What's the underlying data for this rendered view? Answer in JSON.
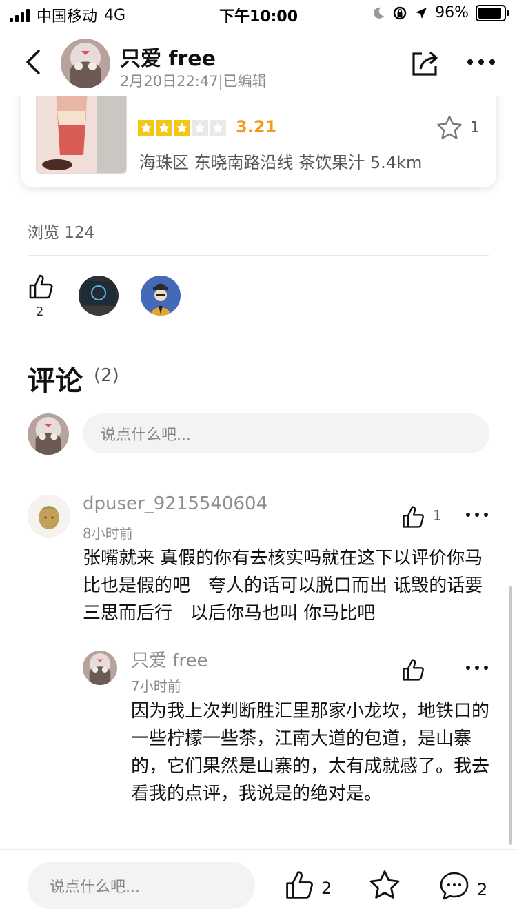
{
  "status_bar": {
    "carrier": "中国移动",
    "network": "4G",
    "time": "下午10:00",
    "battery": "96%"
  },
  "header": {
    "author": "只爱 free",
    "meta": "2月20日22:47|已编辑"
  },
  "shop": {
    "rating": "3.21",
    "rating_value": 3.21,
    "stars_filled": 3,
    "stars_total": 5,
    "info": "海珠区 东晓南路沿线 茶饮果汁   5.4km",
    "favorite_count": "1"
  },
  "stats": {
    "views": "浏览 124",
    "like_count": "2"
  },
  "comments": {
    "title": "评论",
    "count": "(2)",
    "input_placeholder": "说点什么吧...",
    "items": [
      {
        "user": "dpuser_9215540604",
        "time": "8小时前",
        "text": "张嘴就来 真假的你有去核实吗就在这下以评价你马比也是假的吧　夸人的话可以脱口而出 诋毁的话要三思而后行　以后你马也叫 你马比吧",
        "likes": "1"
      }
    ],
    "reply": {
      "user": "只爱 free",
      "time": "7小时前",
      "text": "因为我上次判断胜汇里那家小龙坎，地铁口的一些柠檬一些茶，江南大道的包道，是山寨的，它们果然是山寨的，太有成就感了。我去看我的点评，我说是的绝对是。"
    }
  },
  "bottom_bar": {
    "input_placeholder": "说点什么吧...",
    "like_count": "2",
    "comment_count": "2"
  },
  "colors": {
    "rating": "#f39a1a",
    "star": "#f5c518",
    "muted": "#8d8d8d"
  }
}
